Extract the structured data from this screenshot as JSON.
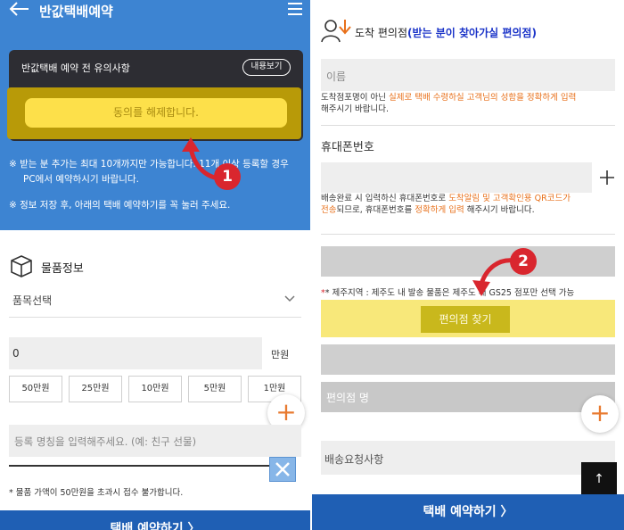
{
  "left": {
    "header_title": "반값택배예약",
    "notice_title": "반값택배 예약 전 유의사항",
    "view_button": "내용보기",
    "agree_button": "동의를 해제합니다.",
    "step1": "1",
    "note1_line1": "※ 받는 분 추가는 최대 10개까지만 가능합니다. 11개 이상 등록할 경우",
    "note1_line2": "PC에서 예약하시기 바랍니다.",
    "note2": "※ 정보 저장 후, 아래의 택배 예약하기를 꼭 눌러 주세요.",
    "section_title": "물품정보",
    "select_placeholder": "품목선택",
    "amount_value": "0",
    "amount_unit": "만원",
    "amount_buttons": [
      "50만원",
      "25만원",
      "10만원",
      "5만원",
      "1만원"
    ],
    "name_placeholder": "등록 명칭을 입력해주세요. (예: 친구 선물)",
    "price_note": "*  물품 가액이 50만원을 초과시 접수 불가합니다.",
    "bottom_button": "택배 예약하기 〉"
  },
  "right": {
    "section_title_a": "도착 편의점",
    "section_title_b": "(받는 분이 찾아가실 편의점)",
    "name_placeholder": "이름",
    "desc1_a": "도착점포명이 아닌 ",
    "desc1_b": "실제로 택배 수령하실 고객님의 성함을 정확하게 입력",
    "desc1_c": "해주시기 바랍니다.",
    "phone_label": "휴대폰번호",
    "desc2_a": "배송완료 시 입력하신 휴대폰번호로 ",
    "desc2_b": "도착알림 및 고객확인용 QR코드가",
    "desc2_c": "전송",
    "desc2_d": "되므로, 휴대폰번호를 ",
    "desc2_e": "정확하게 입력",
    "desc2_f": " 해주시기 바랍니다.",
    "step2": "2",
    "jeju_note": "*   제주지역 : 제주도 내 발송 물품은 제주도 내 GS25 점포만 선택 가능",
    "find_store_button": "편의점 찾기",
    "store_name_label": "편의점 명",
    "delivery_request_placeholder": "배송요청사항",
    "top_button": "↑",
    "bottom_button": "택배 예약하기 〉"
  }
}
